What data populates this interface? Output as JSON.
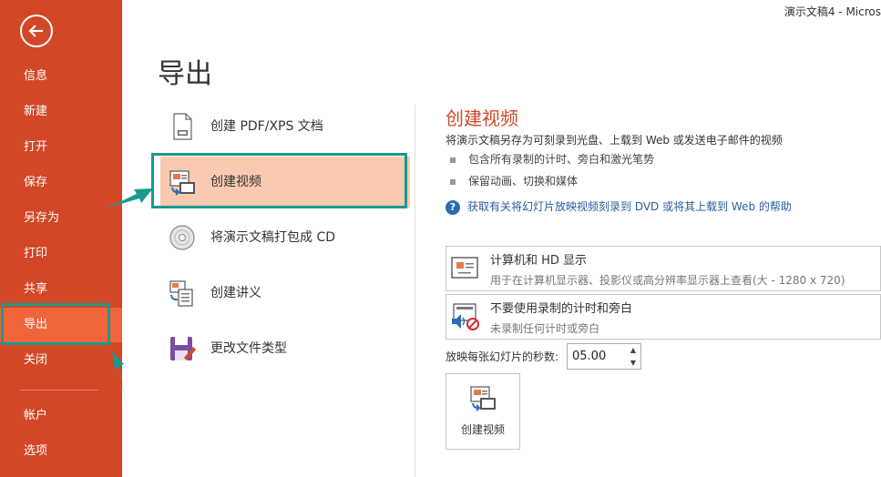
{
  "window": {
    "title": "演示文稿4 - Micros"
  },
  "sidebar": {
    "back_icon": "back-arrow-icon",
    "items": [
      {
        "label": "信息"
      },
      {
        "label": "新建"
      },
      {
        "label": "打开"
      },
      {
        "label": "保存"
      },
      {
        "label": "另存为"
      },
      {
        "label": "打印"
      },
      {
        "label": "共享"
      },
      {
        "label": "导出",
        "active": true
      },
      {
        "label": "关闭"
      },
      {
        "label": "帐户"
      },
      {
        "label": "选项"
      }
    ],
    "colors": {
      "background": "#d24726",
      "active": "#f0643c"
    }
  },
  "page": {
    "title": "导出"
  },
  "export_options": [
    {
      "label": "创建 PDF/XPS 文档",
      "icon": "pdf-document-icon"
    },
    {
      "label": "创建视频",
      "icon": "video-icon",
      "active": true
    },
    {
      "label": "将演示文稿打包成 CD",
      "icon": "cd-icon"
    },
    {
      "label": "创建讲义",
      "icon": "handout-icon"
    },
    {
      "label": "更改文件类型",
      "icon": "file-type-icon"
    }
  ],
  "video_panel": {
    "title": "创建视频",
    "description": "将演示文稿另存为可刻录到光盘、上载到 Web 或发送电子邮件的视频",
    "bullets": [
      "包含所有录制的计时、旁白和激光笔势",
      "保留动画、切换和媒体"
    ],
    "help_link": "获取有关将幻灯片放映视频刻录到 DVD 或将其上载到 Web 的帮助",
    "quality_dropdown": {
      "main": "计算机和 HD 显示",
      "sub": "用于在计算机显示器、投影仪或高分辨率显示器上查看(大 - 1280 x 720)"
    },
    "timing_dropdown": {
      "main": "不要使用录制的计时和旁白",
      "sub": "未录制任何计时或旁白"
    },
    "seconds_label": "放映每张幻灯片的秒数:",
    "seconds_value": "05.00",
    "create_button": "创建视频"
  },
  "annotations": {
    "color": "#1a9a8c"
  },
  "accent": "#d24726"
}
